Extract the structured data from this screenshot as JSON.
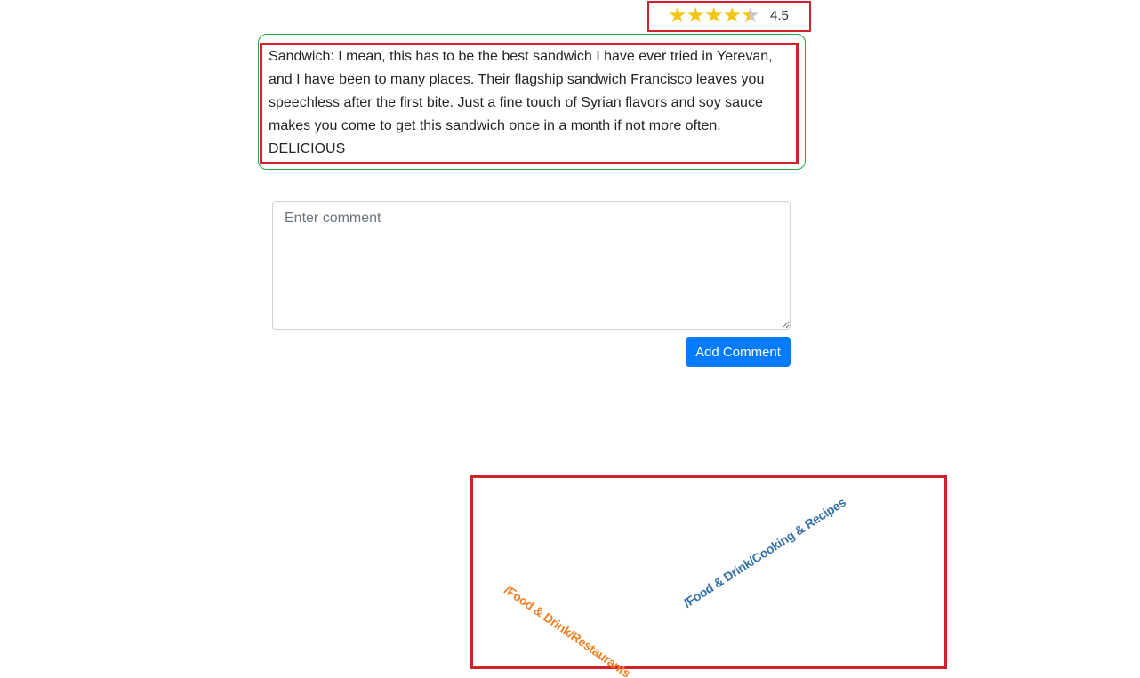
{
  "rating": {
    "stars": [
      "star-full",
      "star-full",
      "star-full",
      "star-full",
      "star-half"
    ],
    "value": "4.5",
    "star_color": "#f5c518"
  },
  "review": {
    "text": "Sandwich: I mean, this has to be the best sandwich I have ever tried in Yerevan, and I have been to many places. Their flagship sandwich Francisco leaves you speechless after the first bite. Just a fine touch of Syrian flavors and soy sauce makes you come to get this sandwich once in a month if not more often. DELICIOUS",
    "border_color": "#28a745"
  },
  "comment": {
    "placeholder": "Enter comment",
    "value": "",
    "button_label": "Add Comment",
    "button_color": "#007bff"
  },
  "categories": [
    {
      "label": "/Food & Drink/Restaurants",
      "color": "#f08025"
    },
    {
      "label": "/Food & Drink/Cooking & Recipes",
      "color": "#3572a8"
    }
  ],
  "highlight_color": "#d3202a"
}
